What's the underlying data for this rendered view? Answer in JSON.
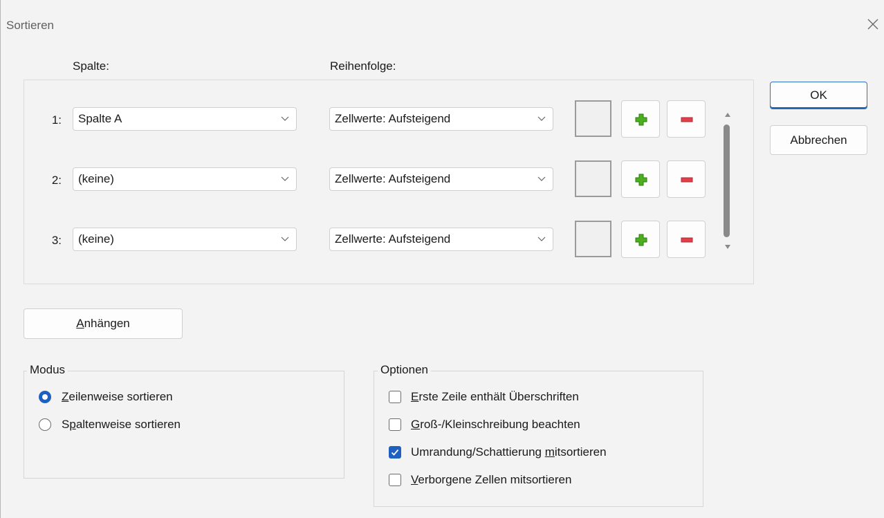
{
  "window": {
    "title": "Sortieren",
    "close_icon": "close-icon"
  },
  "headers": {
    "column": "Spalte:",
    "order": "Reihenfolge:"
  },
  "sort_rows": [
    {
      "num": "1:",
      "column": "Spalte A",
      "order": "Zellwerte: Aufsteigend"
    },
    {
      "num": "2:",
      "column": "(keine)",
      "order": "Zellwerte: Aufsteigend"
    },
    {
      "num": "3:",
      "column": "(keine)",
      "order": "Zellwerte: Aufsteigend"
    }
  ],
  "row_buttons": {
    "add_icon": "plus-icon",
    "remove_icon": "minus-icon",
    "add_color": "#4caf1e",
    "remove_color": "#e0404a"
  },
  "buttons": {
    "ok": "OK",
    "cancel": "Abbrechen",
    "append_mnemonic": "A",
    "append_rest": "nhängen"
  },
  "mode": {
    "title": "Modus",
    "options": [
      {
        "mnemonic": "Z",
        "rest": "eilenweise sortieren",
        "selected": true
      },
      {
        "prefix": "S",
        "mnemonic": "p",
        "rest": "altenweise sortieren",
        "selected": false
      }
    ]
  },
  "options": {
    "title": "Optionen",
    "items": [
      {
        "mnemonic": "E",
        "rest": "rste Zeile enthält Überschriften",
        "checked": false
      },
      {
        "mnemonic": "G",
        "rest": "roß-/Kleinschreibung beachten",
        "checked": false
      },
      {
        "prefix": "Umrandung/Schattierung ",
        "mnemonic": "m",
        "rest": "itsortieren",
        "checked": true
      },
      {
        "mnemonic": "V",
        "rest": "erborgene Zellen mitsortieren",
        "checked": false
      }
    ]
  },
  "colors": {
    "accent": "#1f5fbf",
    "dialog_bg": "#f3f3f3"
  }
}
